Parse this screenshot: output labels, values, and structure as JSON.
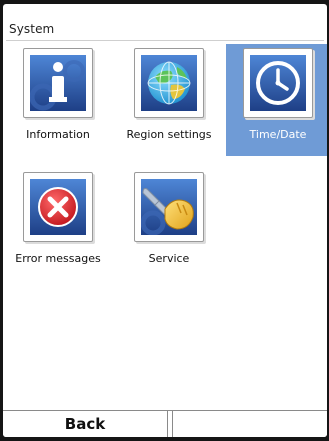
{
  "screen": {
    "title": "System"
  },
  "tiles": [
    {
      "label": "Information",
      "icon": "information-icon",
      "selected": false
    },
    {
      "label": "Region settings",
      "icon": "globe-icon",
      "selected": false
    },
    {
      "label": "Time/Date",
      "icon": "clock-icon",
      "selected": true
    },
    {
      "label": "Error messages",
      "icon": "error-icon",
      "selected": false
    },
    {
      "label": "Service",
      "icon": "wrench-icon",
      "selected": false
    }
  ],
  "softkeys": {
    "left_label": "Back",
    "right_label": ""
  },
  "colors": {
    "selection": "#6f9bd6",
    "icon_blue": "#2f5aa8",
    "error_red": "#d3252b"
  }
}
